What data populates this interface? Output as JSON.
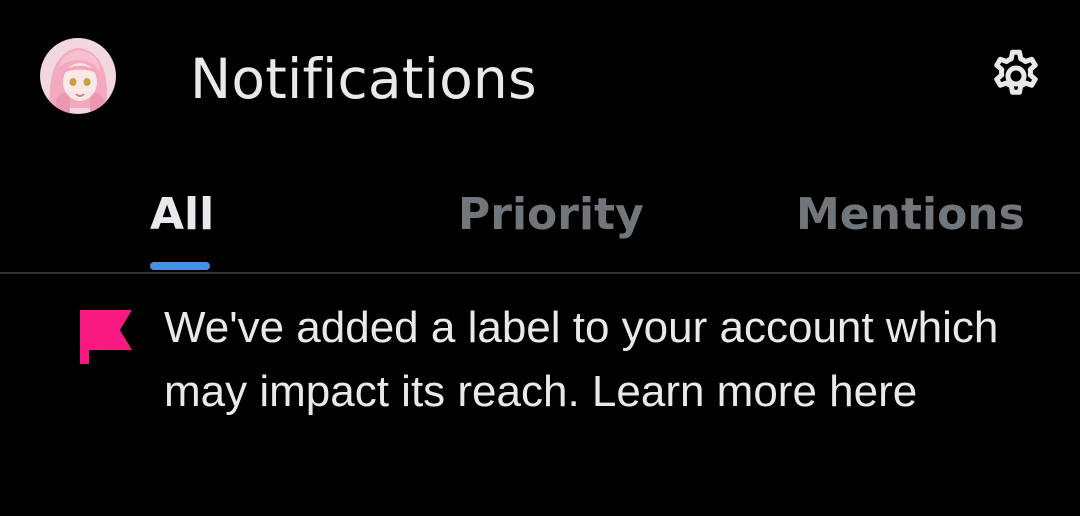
{
  "header": {
    "title": "Notifications",
    "avatar_icon": "user-avatar",
    "settings_icon": "gear-icon"
  },
  "tabs": [
    {
      "label": "All",
      "active": true
    },
    {
      "label": "Priority",
      "active": false
    },
    {
      "label": "Mentions",
      "active": false
    }
  ],
  "notification": {
    "icon": "flag-icon",
    "icon_color": "#f91880",
    "text": "We've added a label to your account which may impact its reach. Learn more here"
  },
  "colors": {
    "background": "#000000",
    "primary_text": "#e7e9ea",
    "secondary_text": "#71767b",
    "tab_indicator": "#4a8ee0",
    "divider": "#2f3336"
  }
}
